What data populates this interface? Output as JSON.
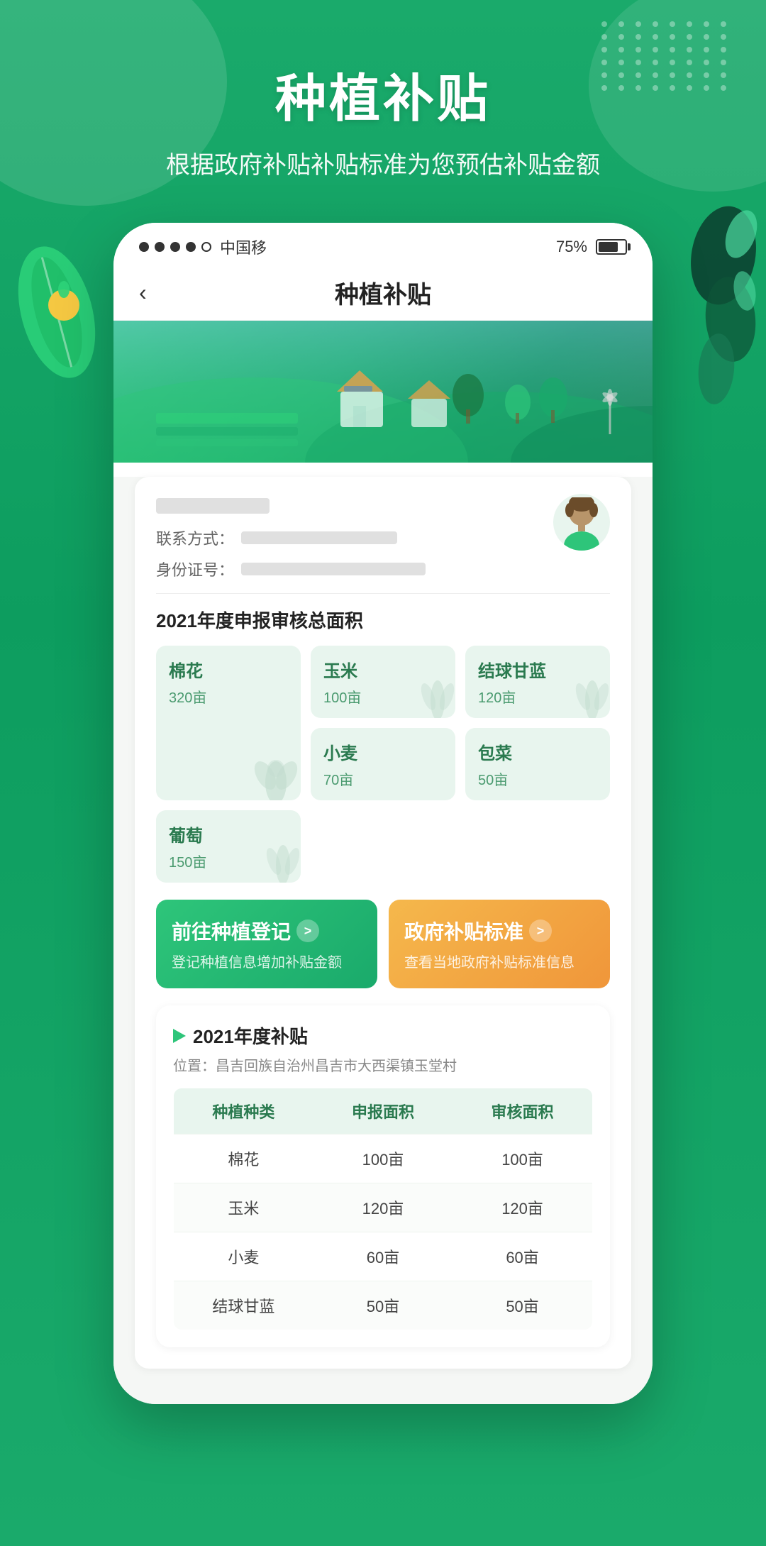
{
  "status_bar": {
    "carrier": "中国移",
    "battery_percent": "75%",
    "signal_dots": [
      "filled",
      "filled",
      "filled",
      "filled",
      "empty",
      "empty"
    ]
  },
  "navbar": {
    "back_icon": "‹",
    "title": "种植补贴"
  },
  "header": {
    "main_title": "种植补贴",
    "subtitle": "根据政府补贴补贴标准为您预估补贴金额"
  },
  "user_card": {
    "contact_label": "联系方式：",
    "id_label": "身份证号："
  },
  "annual_area": {
    "section_title": "2021年度申报审核总面积",
    "crops": [
      {
        "name": "棉花",
        "area": "320亩",
        "wide": true
      },
      {
        "name": "玉米",
        "area": "100亩",
        "wide": false
      },
      {
        "name": "结球甘蓝",
        "area": "120亩",
        "wide": false
      },
      {
        "name": "小麦",
        "area": "70亩",
        "wide": false
      },
      {
        "name": "包菜",
        "area": "50亩",
        "wide": false
      },
      {
        "name": "葡萄",
        "area": "150亩",
        "wide": false
      }
    ]
  },
  "action_buttons": [
    {
      "key": "planting_register",
      "title": "前往种植登记",
      "subtitle": "登记种植信息增加补贴金额",
      "style": "green",
      "arrow": ">"
    },
    {
      "key": "subsidy_standard",
      "title": "政府补贴标准",
      "subtitle": "查看当地政府补贴标准信息",
      "style": "orange",
      "arrow": ">"
    }
  ],
  "subsidy_section": {
    "year_title": "2021年度补贴",
    "location_label": "位置：",
    "location_value": "昌吉回族自治州昌吉市大西渠镇玉堂村",
    "table": {
      "headers": [
        "种植种类",
        "申报面积",
        "审核面积"
      ],
      "rows": [
        {
          "crop": "棉花",
          "reported": "100亩",
          "approved": "100亩"
        },
        {
          "crop": "玉米",
          "reported": "120亩",
          "approved": "120亩"
        },
        {
          "crop": "小麦",
          "reported": "60亩",
          "approved": "60亩"
        },
        {
          "crop": "结球甘蓝",
          "reported": "50亩",
          "approved": "50亩"
        }
      ]
    }
  }
}
